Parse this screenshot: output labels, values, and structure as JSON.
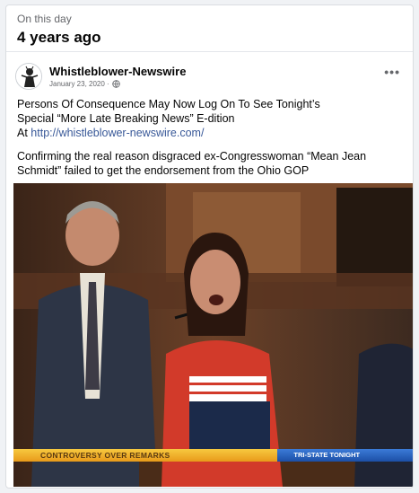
{
  "memory": {
    "label": "On this day",
    "when": "4 years ago"
  },
  "post": {
    "page_name": "Whistleblower-Newswire",
    "date": "January 23, 2020 ·",
    "menu_label": "•••",
    "paragraph1_line1": "Persons Of Consequence May Now Log On To See Tonight’s",
    "paragraph1_line2": "Special “More Late Breaking News” E-dition",
    "paragraph1_prefix": "At ",
    "link_text": "http://whistleblower-newswire.com/",
    "paragraph2_line1": "Confirming the real reason disgraced ex-Congresswoman “Mean Jean",
    "paragraph2_line2": "Schmidt” failed to get the endorsement from the Ohio GOP"
  },
  "media": {
    "chyron_left": "CONTROVERSY OVER REMARKS",
    "chyron_right": "TRI-STATE TONIGHT"
  },
  "icons": {
    "avatar": "newswire-logo-icon",
    "privacy": "globe-icon",
    "menu": "more-options-icon"
  }
}
